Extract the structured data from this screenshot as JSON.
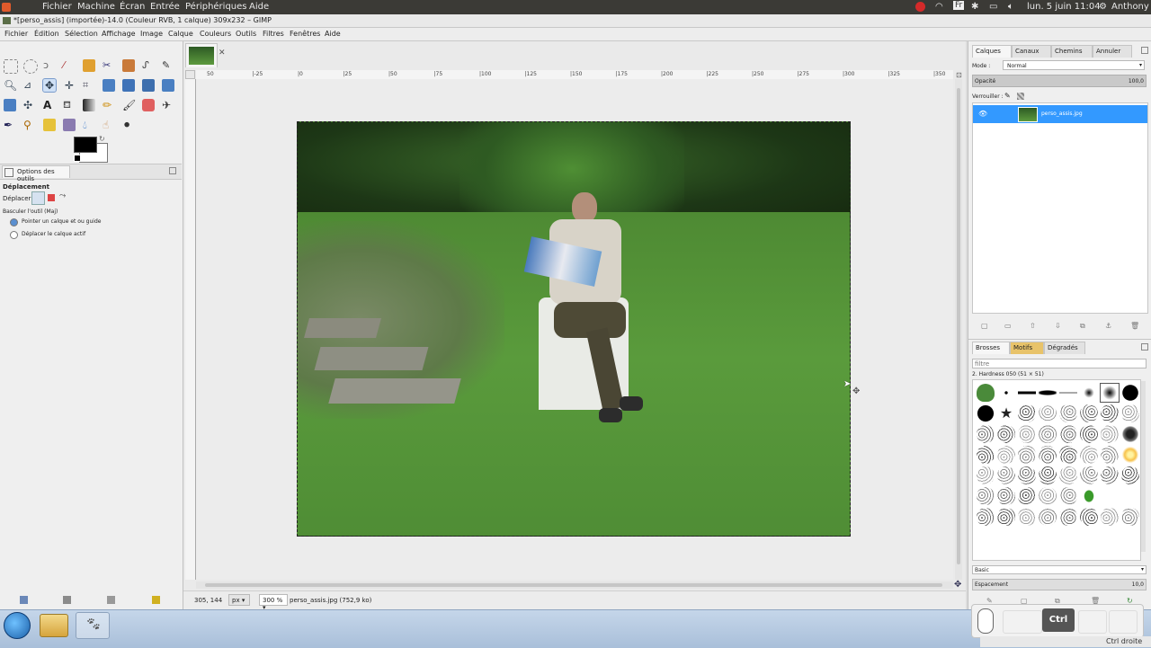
{
  "host": {
    "menu": [
      "Fichier",
      "Machine",
      "Écran",
      "Entrée",
      "Périphériques",
      "Aide"
    ],
    "clock": "lun. 5 juin 11:04",
    "user": "Anthony",
    "lang": "Fr"
  },
  "gimp": {
    "title": "*[perso_assis] (importée)-14.0 (Couleur RVB, 1 calque) 309x232 – GIMP",
    "menu": [
      "Fichier",
      "Édition",
      "Sélection",
      "Affichage",
      "Image",
      "Calque",
      "Couleurs",
      "Outils",
      "Filtres",
      "Fenêtres",
      "Aide"
    ]
  },
  "tool_options": {
    "tab": "Options des outils",
    "heading": "Déplacement",
    "move_label": "Déplacer :",
    "toggle_label": "Basculer l'outil  (Maj)",
    "radio1": "Pointer un calque et ou guide",
    "radio2": "Déplacer le calque actif"
  },
  "ruler": {
    "h_ticks": [
      "50",
      "|-25",
      "|0",
      "|25",
      "|50",
      "|75",
      "|100",
      "|125",
      "|150",
      "|175",
      "|200",
      "|225",
      "|250",
      "|275",
      "|300",
      "|325",
      "|350"
    ]
  },
  "status": {
    "coords": "305, 144",
    "unit": "px",
    "zoom": "300 %",
    "file": "perso_assis.jpg (752,9 ko)"
  },
  "layers": {
    "tabs": [
      "Calques",
      "Canaux",
      "Chemins",
      "Annuler"
    ],
    "mode_label": "Mode :",
    "mode_value": "Normal",
    "opacity_label": "Opacité",
    "opacity_value": "100,0",
    "lock_label": "Verrouiller :",
    "layer_name": "perso_assis.jpg"
  },
  "brushes": {
    "tabs": [
      "Brosses",
      "Motifs",
      "Dégradés"
    ],
    "filter_placeholder": "filtre",
    "current": "2. Hardness 050 (51 × 51)",
    "preset": "Basic",
    "spacing_label": "Espacement",
    "spacing_value": "10,0"
  },
  "overlay": {
    "ctrl_label": "Ctrl",
    "host_key": "Ctrl droite"
  },
  "colors": {
    "selection": "#3399ff",
    "fg": "#000000",
    "bg": "#ffffff"
  }
}
